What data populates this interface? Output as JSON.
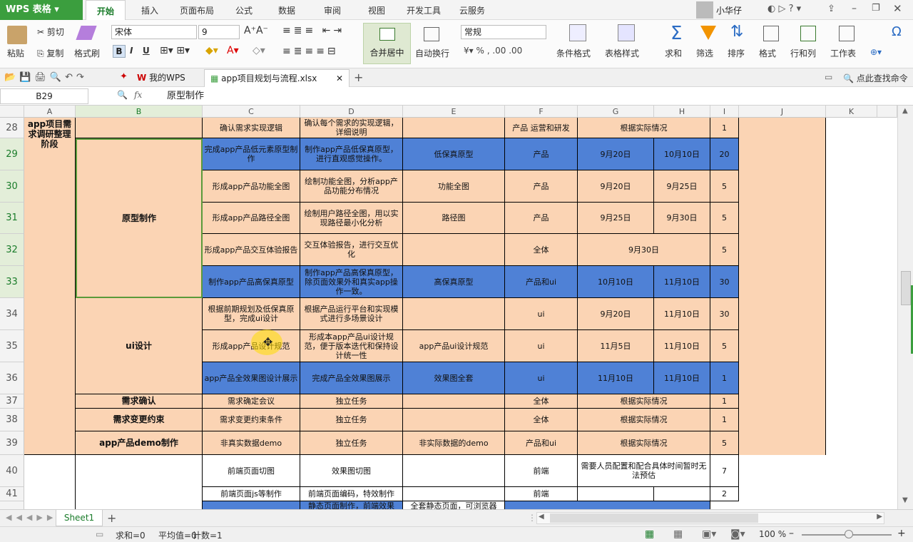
{
  "app": {
    "name": "WPS 表格",
    "user": "小华仔"
  },
  "ribbon_tabs": [
    "开始",
    "插入",
    "页面布局",
    "公式",
    "数据",
    "审阅",
    "视图",
    "开发工具",
    "云服务"
  ],
  "ribbon": {
    "paste": "粘贴",
    "cut": "剪切",
    "copy": "复制",
    "format_painter": "格式刷",
    "font_name": "宋体",
    "font_size": "9",
    "merge_center": "合并居中",
    "wrap_text": "自动换行",
    "number_format": "常规",
    "conditional_format": "条件格式",
    "table_style": "表格样式",
    "sum": "求和",
    "filter": "筛选",
    "sort": "排序",
    "format": "格式",
    "row_col": "行和列",
    "worksheet": "工作表",
    "bold": "B",
    "italic": "I",
    "underline": "U"
  },
  "doc_tabs": {
    "my_wps": "我的WPS",
    "file": "app项目规划与流程.xlsx",
    "find_cmd": "点此查找命令"
  },
  "formula_bar": {
    "cell_ref": "B29",
    "content": "原型制作",
    "fx": "fx"
  },
  "columns": [
    "A",
    "B",
    "C",
    "D",
    "E",
    "F",
    "G",
    "H",
    "I",
    "J",
    "K"
  ],
  "rows": [
    "28",
    "29",
    "30",
    "31",
    "32",
    "33",
    "34",
    "35",
    "36",
    "37",
    "38",
    "39",
    "40",
    "41"
  ],
  "merged": {
    "a_stage": "app项目需求调研整理阶段",
    "b_prototype": "原型制作",
    "b_ui": "ui设计"
  },
  "cells": {
    "r28": {
      "c": "确认需求实现逻辑",
      "d": "确认每个需求的实现逻辑，详细说明",
      "e": "",
      "f": "产品 运营和研发",
      "gh": "根据实际情况",
      "i": "1"
    },
    "r29": {
      "c": "完成app产品低元素原型制作",
      "d": "制作app产品低保真原型，进行直观感觉操作。",
      "e": "低保真原型",
      "f": "产品",
      "g": "9月20日",
      "h": "10月10日",
      "i": "20"
    },
    "r30": {
      "c": "形成app产品功能全图",
      "d": "绘制功能全图，分析app产品功能分布情况",
      "e": "功能全图",
      "f": "产品",
      "g": "9月20日",
      "h": "9月25日",
      "i": "5"
    },
    "r31": {
      "c": "形成app产品路径全图",
      "d": "绘制用户路径全图，用以实现路径最小化分析",
      "e": "路径图",
      "f": "产品",
      "g": "9月25日",
      "h": "9月30日",
      "i": "5"
    },
    "r32": {
      "c": "形成app产品交互体验报告",
      "d": "交互体验报告，进行交互优化",
      "e": "",
      "f": "全体",
      "gh": "9月30日",
      "i": "5"
    },
    "r33": {
      "c": "制作app产品高保真原型",
      "d": "制作app产品高保真原型，除页面效果外和真实app操作一致。",
      "e": "高保真原型",
      "f": "产品和ui",
      "g": "10月10日",
      "h": "11月10日",
      "i": "30"
    },
    "r34": {
      "c": "根据前期规划及低保真原型，完成ui设计",
      "d": "根据产品运行平台和实现模式进行多场景设计",
      "e": "",
      "f": "ui",
      "g": "9月20日",
      "h": "11月10日",
      "i": "30"
    },
    "r35": {
      "c": "形成app产品设计规范",
      "d": "形成本app产品ui设计规范，便于版本迭代和保持设计统一性",
      "e": "app产品ui设计规范",
      "f": "ui",
      "g": "11月5日",
      "h": "11月10日",
      "i": "5"
    },
    "r36": {
      "c": "app产品全效果图设计展示",
      "d": "完成产品全效果图展示",
      "e": "效果图全套",
      "f": "ui",
      "g": "11月10日",
      "h": "11月10日",
      "i": "1"
    },
    "r37": {
      "b": "需求确认",
      "c": "需求确定会议",
      "d": "独立任务",
      "e": "",
      "f": "全体",
      "gh": "根据实际情况",
      "i": "1"
    },
    "r38": {
      "b": "需求变更约束",
      "c": "需求变更约束条件",
      "d": "独立任务",
      "e": "",
      "f": "全体",
      "gh": "根据实际情况",
      "i": "1"
    },
    "r39": {
      "b": "app产品demo制作",
      "c": "非真实数据demo",
      "d": "独立任务",
      "e": "非实际数据的demo",
      "f": "产品和ui",
      "gh": "根据实际情况",
      "i": "5"
    },
    "r40": {
      "c": "前端页面切图",
      "d": "效果图切图",
      "e": "",
      "f": "前端",
      "gh": "需要人员配置和配合具体时间暂时无法预估",
      "i": "7"
    },
    "r41": {
      "c": "前端页面js等制作",
      "d": "前端页面编码，特效制作",
      "e": "",
      "f": "前端",
      "g": "",
      "h": "",
      "i": "2"
    },
    "r42": {
      "d": "静态页面制作，前端效果",
      "e": "全套静态页面，可浏览器"
    }
  },
  "sheet_tab": "Sheet1",
  "status": {
    "sum": "求和=0",
    "avg": "平均值=0",
    "count": "计数=1",
    "zoom": "100 %"
  },
  "colors": {
    "peach": "#fbd4b4",
    "blue": "#4f81d6",
    "accent": "#3b9e3e"
  }
}
